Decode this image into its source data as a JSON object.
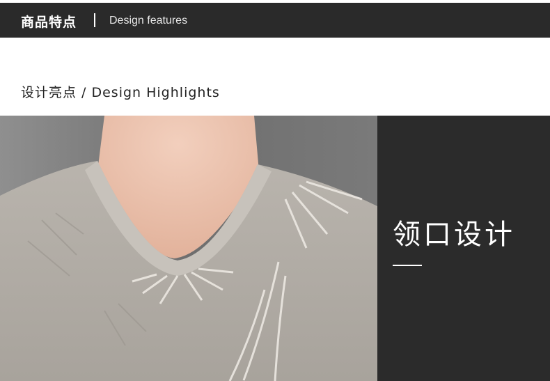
{
  "header": {
    "title_cn": "商品特点",
    "title_en": "Design features"
  },
  "section": {
    "title": "设计亮点 / Design Highlights"
  },
  "feature": {
    "title": "领口设计"
  }
}
